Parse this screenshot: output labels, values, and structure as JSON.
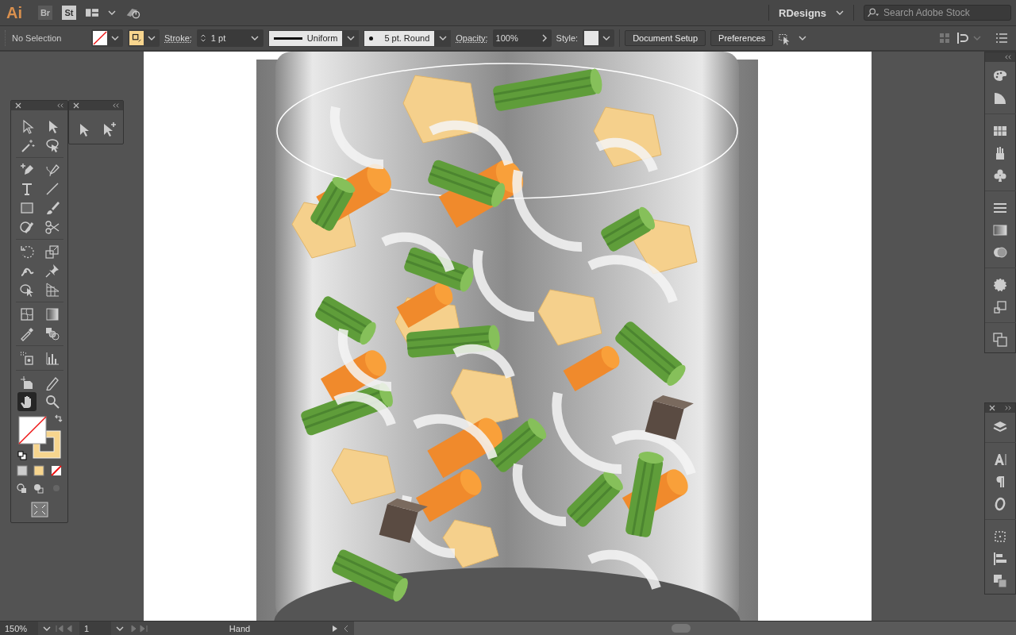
{
  "app_bar": {
    "logo": "Ai",
    "bridge": "Br",
    "stock": "St",
    "workspace": "RDesigns",
    "search": {
      "placeholder": "Search Adobe Stock"
    }
  },
  "control_bar": {
    "selection": "No Selection",
    "stroke_label": "Stroke:",
    "stroke_weight": "1 pt",
    "profile": "Uniform",
    "brush": "5 pt. Round",
    "opacity_label": "Opacity:",
    "opacity": "100%",
    "style_label": "Style:",
    "buttons": [
      "Document Setup",
      "Preferences"
    ]
  },
  "tools": [
    {
      "kind": "selection",
      "selected": false
    },
    {
      "kind": "direct",
      "selected": false
    },
    {
      "kind": "wand",
      "selected": false
    },
    {
      "kind": "lasso",
      "selected": false
    },
    {
      "kind": "pen",
      "selected": false
    },
    {
      "kind": "curvature",
      "selected": false
    },
    {
      "kind": "type",
      "selected": false
    },
    {
      "kind": "line",
      "selected": false
    },
    {
      "kind": "rect",
      "selected": false
    },
    {
      "kind": "brush",
      "selected": false
    },
    {
      "kind": "shaper",
      "selected": false
    },
    {
      "kind": "scissors",
      "selected": false
    },
    {
      "kind": "rotate",
      "selected": false
    },
    {
      "kind": "scale",
      "selected": false
    },
    {
      "kind": "puppet",
      "selected": false
    },
    {
      "kind": "pin",
      "selected": false
    },
    {
      "kind": "free",
      "selected": false
    },
    {
      "kind": "perspective",
      "selected": false
    },
    {
      "kind": "mesh",
      "selected": false
    },
    {
      "kind": "gradient",
      "selected": false
    },
    {
      "kind": "eyedropper",
      "selected": false
    },
    {
      "kind": "blend",
      "selected": false
    },
    {
      "kind": "sprayer",
      "selected": false
    },
    {
      "kind": "graph",
      "selected": false
    },
    {
      "kind": "artboard",
      "selected": false
    },
    {
      "kind": "pencil",
      "selected": false
    },
    {
      "kind": "hand",
      "selected": true
    },
    {
      "kind": "zoom",
      "selected": false
    }
  ],
  "status_bar": {
    "zoom": "150%",
    "artboard": "1",
    "tool": "Hand"
  }
}
